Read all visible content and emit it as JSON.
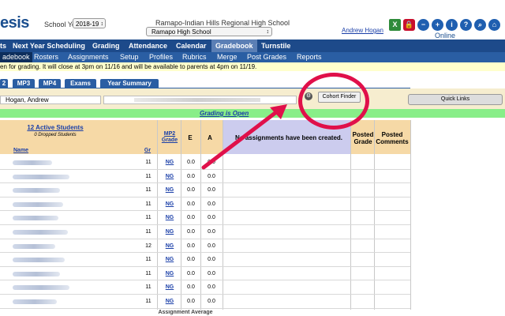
{
  "header": {
    "logo_text": "esis",
    "school_year_label": "School Year:",
    "school_year_value": "2018-19",
    "district": "Ramapo-Indian Hills Regional High School District",
    "school_value": "Ramapo High School",
    "user_name": "Andrew Hogan",
    "online_documentation": "Online Documentation",
    "icons": [
      "excel-icon",
      "lock-icon",
      "minus-icon",
      "plus-icon",
      "info-icon",
      "help-icon",
      "search-icon",
      "home-icon"
    ]
  },
  "nav_primary": {
    "items": [
      "ts",
      "Next Year Scheduling",
      "Grading",
      "Attendance",
      "Calendar",
      "Gradebook",
      "Turnstile"
    ],
    "active": "Gradebook"
  },
  "nav_secondary": {
    "items": [
      "adebook",
      "Rosters",
      "Assignments",
      "Setup",
      "Profiles",
      "Rubrics",
      "Merge",
      "Post Grades",
      "Reports"
    ],
    "active": "adebook"
  },
  "notice": "en for grading. It will close at 3pm on 11/16 and will be available to parents at 4pm on 11/19.",
  "tabs": [
    "2",
    "MP3",
    "MP4",
    "Exams",
    "Year Summary"
  ],
  "toolbar": {
    "teacher_name": "Hogan, Andrew",
    "cohort_finder": "Cohort Finder",
    "quick_links": "Quick Links"
  },
  "grading_status": "Grading is Open",
  "table": {
    "active_students": "12 Active Students",
    "dropped_students": "0 Dropped Students",
    "col_name": "Name",
    "col_gr": "Gr",
    "col_mp2": "MP2",
    "col_grade": "Grade",
    "col_e": "E",
    "col_a": "A",
    "no_assignments": "No assignments have been created.",
    "col_posted_grade_1": "Posted",
    "col_posted_grade_2": "Grade",
    "col_posted_comments_1": "Posted",
    "col_posted_comments_2": "Comments",
    "footer_partial": "Assignment Average",
    "rows": [
      {
        "gr": "11",
        "mp2": "NG",
        "e": "0.0",
        "a": "0.0"
      },
      {
        "gr": "11",
        "mp2": "NG",
        "e": "0.0",
        "a": "0.0"
      },
      {
        "gr": "11",
        "mp2": "NG",
        "e": "0.0",
        "a": "0.0"
      },
      {
        "gr": "11",
        "mp2": "NG",
        "e": "0.0",
        "a": "0.0"
      },
      {
        "gr": "11",
        "mp2": "NG",
        "e": "0.0",
        "a": "0.0"
      },
      {
        "gr": "11",
        "mp2": "NG",
        "e": "0.0",
        "a": "0.0"
      },
      {
        "gr": "12",
        "mp2": "NG",
        "e": "0.0",
        "a": "0.0"
      },
      {
        "gr": "11",
        "mp2": "NG",
        "e": "0.0",
        "a": "0.0"
      },
      {
        "gr": "11",
        "mp2": "NG",
        "e": "0.0",
        "a": "0.0"
      },
      {
        "gr": "11",
        "mp2": "NG",
        "e": "0.0",
        "a": "0.0"
      },
      {
        "gr": "11",
        "mp2": "NG",
        "e": "0.0",
        "a": "0.0"
      }
    ]
  },
  "colors": {
    "nav_primary": "#1d4a8a",
    "nav_secondary": "#2a5ea3",
    "header_tan": "#f6d9a6",
    "lavender": "#ccccee",
    "grading_green": "#88ee88",
    "annotation": "#e0104a"
  }
}
